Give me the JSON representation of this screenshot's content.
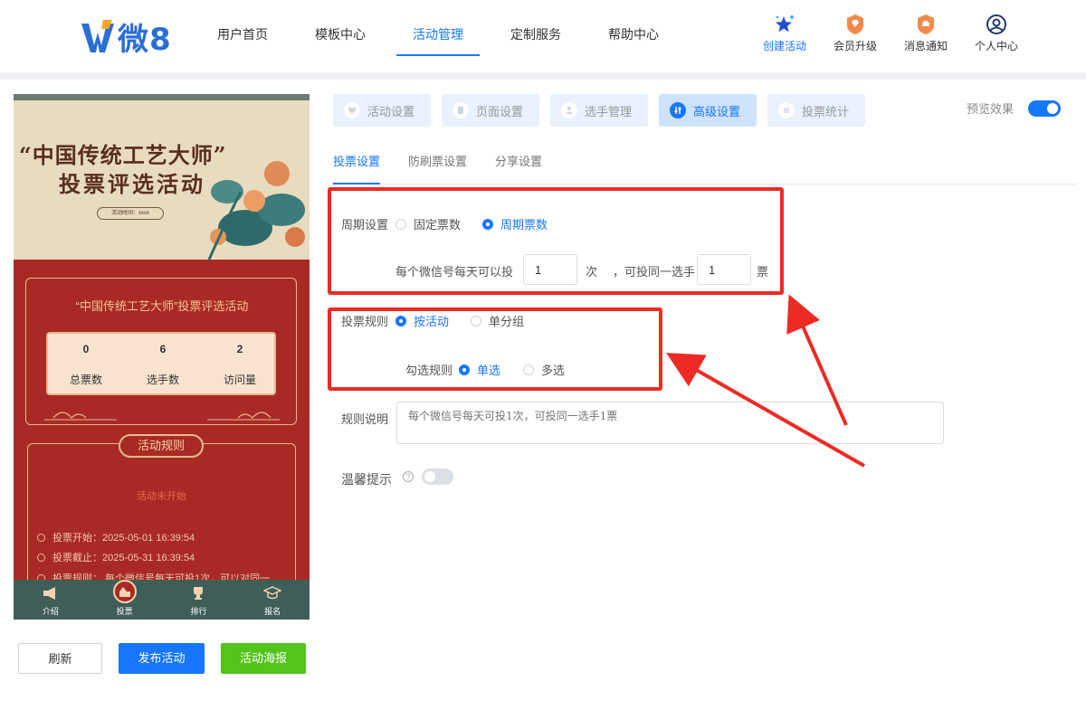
{
  "header": {
    "logo_text": "微8",
    "nav": [
      "用户首页",
      "模板中心",
      "活动管理",
      "定制服务",
      "帮助中心"
    ],
    "active_nav": 2,
    "actions": [
      {
        "label": "创建活动",
        "icon": "star-burst-icon"
      },
      {
        "label": "会员升级",
        "icon": "gem-badge-icon"
      },
      {
        "label": "消息通知",
        "icon": "bell-badge-icon"
      },
      {
        "label": "个人中心",
        "icon": "user-circle-icon"
      }
    ]
  },
  "phone": {
    "poster_title_1": "“中国传统工艺大师”",
    "poster_title_2": "投票评选活动",
    "poster_time": "活动时间：xxxx",
    "stat_title": "“中国传统工艺大师”投票评选活动",
    "stats": [
      {
        "value": "0",
        "label": "总票数"
      },
      {
        "value": "6",
        "label": "选手数"
      },
      {
        "value": "2",
        "label": "访问量"
      }
    ],
    "rule_badge": "活动规则",
    "rule_status": "活动未开始",
    "rule_lines": [
      "投票开始：2025-05-01 16:39:54",
      "投票截止：2025-05-31 16:39:54",
      "投票规则：  每个微信号每天可投1次，可以对同一"
    ],
    "bottom_nav": [
      "介绍",
      "投票",
      "排行",
      "报名"
    ],
    "active_bottom": 1,
    "buttons": {
      "refresh": "刷新",
      "publish": "发布活动",
      "poster": "活动海报"
    }
  },
  "steps": [
    "活动设置",
    "页面设置",
    "选手管理",
    "高级设置",
    "投票统计"
  ],
  "active_step": 3,
  "preview_label": "预览效果",
  "subtabs": [
    "投票设置",
    "防刷票设置",
    "分享设置"
  ],
  "form": {
    "period_label": "周期设置",
    "period_fixed": "固定票数",
    "period_cycle": "周期票数",
    "daily_prefix": "每个微信号每天可以投",
    "daily_times": "1",
    "times_unit": "次",
    "same_prefix": "，可投同一选手",
    "same_votes": "1",
    "votes_unit": "票",
    "rule_label": "投票规则",
    "rule_by_activity": "按活动",
    "rule_by_group": "单分组",
    "select_label": "勾选规则",
    "select_single": "单选",
    "select_multi": "多选",
    "desc_label": "规则说明",
    "desc_placeholder": "每个微信号每天可投1次，可投同一选手1票",
    "tip_label": "温馨提示",
    "tip_help": "?"
  },
  "colors": {
    "accent": "#1677ff",
    "highlight": "#ee2a24",
    "poster_red": "#a92a25",
    "publish_green": "#52c41a"
  }
}
